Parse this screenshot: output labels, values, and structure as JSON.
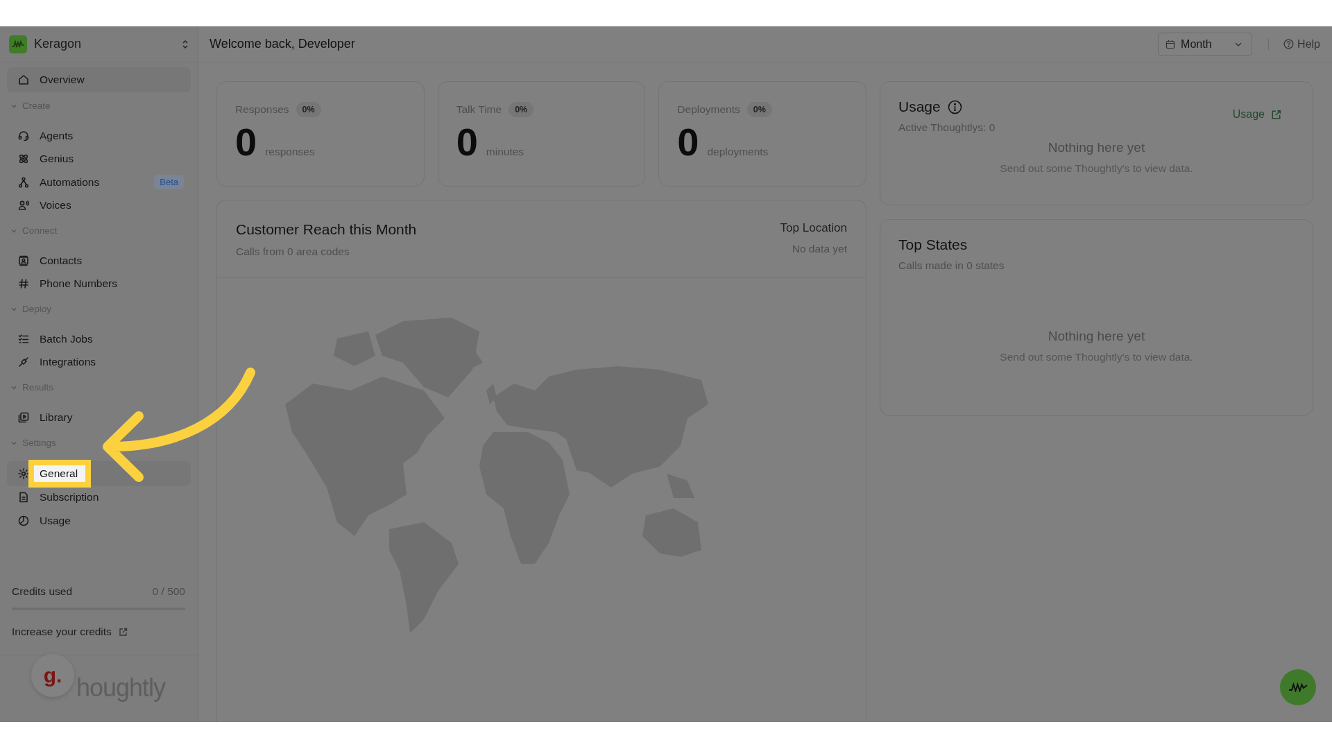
{
  "brand": {
    "name": "Keragon"
  },
  "sidebar": {
    "items": [
      {
        "label": "Overview",
        "selected": true
      }
    ],
    "sections": [
      {
        "title": "Create",
        "expanded": true,
        "items": [
          {
            "label": "Agents",
            "selected": false
          },
          {
            "label": "Genius",
            "selected": false
          },
          {
            "label": "Automations",
            "selected": false,
            "badge": "Beta"
          },
          {
            "label": "Voices",
            "selected": false
          }
        ]
      },
      {
        "title": "Connect",
        "expanded": true,
        "items": [
          {
            "label": "Contacts",
            "selected": false
          },
          {
            "label": "Phone Numbers",
            "selected": false
          }
        ]
      },
      {
        "title": "Deploy",
        "expanded": true,
        "items": [
          {
            "label": "Batch Jobs",
            "selected": false
          },
          {
            "label": "Integrations",
            "selected": false
          }
        ]
      },
      {
        "title": "Results",
        "expanded": true,
        "items": [
          {
            "label": "Library",
            "selected": false
          }
        ]
      },
      {
        "title": "Settings",
        "expanded": true,
        "items": [
          {
            "label": "General",
            "selected": true,
            "highlighted": true
          },
          {
            "label": "Subscription",
            "selected": false
          },
          {
            "label": "Usage",
            "selected": false
          }
        ]
      }
    ],
    "credits": {
      "label": "Credits used",
      "value": "0 / 500",
      "level": 0
    },
    "increase_link": "Increase your credits",
    "avatar": "g.",
    "logo_text": "houghtly"
  },
  "header": {
    "title": "Welcome back, Developer",
    "period": {
      "value": "Month"
    },
    "help": "Help"
  },
  "stats": [
    {
      "label": "Responses",
      "change": "0%",
      "value": "0",
      "unit": "responses"
    },
    {
      "label": "Talk Time",
      "change": "0%",
      "value": "0",
      "unit": "minutes"
    },
    {
      "label": "Deployments",
      "change": "0%",
      "value": "0",
      "unit": "deployments"
    }
  ],
  "reach": {
    "title": "Customer Reach this Month",
    "subtitle": "Calls from 0 area codes",
    "top_location_label": "Top Location",
    "top_location_value": "No data yet"
  },
  "usage": {
    "title": "Usage",
    "subtitle": "Active Thoughtlys: 0",
    "link": "Usage",
    "empty_title": "Nothing here yet",
    "empty_text": "Send out some Thoughtly's to view data."
  },
  "top_states": {
    "title": "Top States",
    "subtitle": "Calls made in 0 states",
    "empty_title": "Nothing here yet",
    "empty_text": "Send out some Thoughtly's to view data."
  }
}
